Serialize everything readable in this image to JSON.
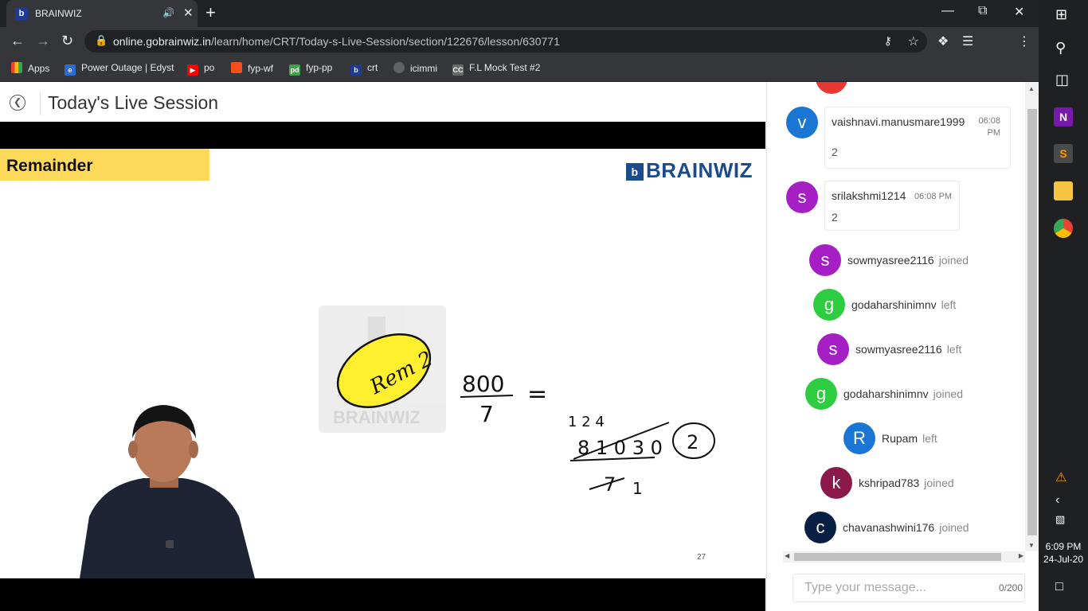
{
  "browser": {
    "tab_title": "BRAINWIZ",
    "tab_favicon": "b",
    "url_host": "online.gobrainwiz.in",
    "url_path": "/learn/home/CRT/Today-s-Live-Session/section/122676/lesson/630771",
    "bookmarks": [
      "Apps",
      "Power Outage | Edyst",
      "po",
      "fyp-wf",
      "fyp-pp",
      "crt",
      "icimmi",
      "F.L Mock Test #2"
    ]
  },
  "page": {
    "title": "Today's Live Session"
  },
  "slide": {
    "banner": "Remainder",
    "logo": "BRAINWIZ",
    "watermark": "BRAINWIZ",
    "page_number": "27",
    "handwriting": {
      "rem_label": "Rem 2",
      "numerator": "800",
      "denominator": "7",
      "equals": "=",
      "carry_marks": "1 2 4",
      "reduced": "8 1 0 3 0",
      "divisor": "7",
      "one": "1",
      "answer": "2"
    }
  },
  "chat": {
    "messages": [
      {
        "user": "vaishnavi.manusmare1999",
        "initial": "v",
        "time": "06:08 PM",
        "text": "2",
        "color": "#1976d2"
      },
      {
        "user": "srilakshmi1214",
        "initial": "s",
        "time": "06:08 PM",
        "text": "2",
        "color": "#a51fc4"
      }
    ],
    "events": [
      {
        "user": "sowmyasree2116",
        "initial": "s",
        "action": "joined",
        "color": "#a51fc4"
      },
      {
        "user": "godaharshinimnv",
        "initial": "g",
        "action": "left",
        "color": "#2ecc40"
      },
      {
        "user": "sowmyasree2116",
        "initial": "s",
        "action": "left",
        "color": "#a51fc4"
      },
      {
        "user": "godaharshinimnv",
        "initial": "g",
        "action": "joined",
        "color": "#2ecc40"
      },
      {
        "user": "Rupam",
        "initial": "R",
        "action": "left",
        "color": "#1976d2"
      },
      {
        "user": "kshripad783",
        "initial": "k",
        "action": "joined",
        "color": "#8b1a4a"
      },
      {
        "user": "chavanashwini176",
        "initial": "c",
        "action": "joined",
        "color": "#0a1f44"
      }
    ],
    "compose_placeholder": "Type your message...",
    "char_count": "0/200"
  },
  "taskbar": {
    "time": "6:09 PM",
    "date": "24-Jul-20"
  }
}
